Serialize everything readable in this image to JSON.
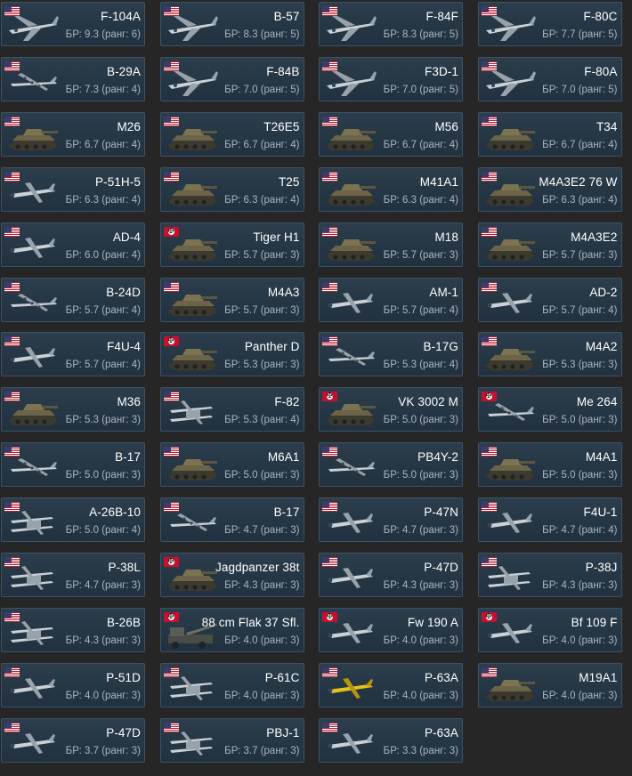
{
  "br_prefix": "БР:",
  "rank_prefix": "ранг:",
  "vehicles": [
    {
      "name": "F-104A",
      "br": "9.3",
      "rank": "6",
      "type": "jet",
      "nation": "usa"
    },
    {
      "name": "B-57",
      "br": "8.3",
      "rank": "5",
      "type": "jet",
      "nation": "usa"
    },
    {
      "name": "F-84F",
      "br": "8.3",
      "rank": "5",
      "type": "jet",
      "nation": "usa"
    },
    {
      "name": "F-80C",
      "br": "7.7",
      "rank": "5",
      "type": "jet",
      "nation": "usa"
    },
    {
      "name": "B-29A",
      "br": "7.3",
      "rank": "4",
      "type": "bomber",
      "nation": "usa"
    },
    {
      "name": "F-84B",
      "br": "7.0",
      "rank": "5",
      "type": "jet",
      "nation": "usa"
    },
    {
      "name": "F3D-1",
      "br": "7.0",
      "rank": "5",
      "type": "jet",
      "nation": "usa"
    },
    {
      "name": "F-80A",
      "br": "7.0",
      "rank": "5",
      "type": "jet",
      "nation": "usa"
    },
    {
      "name": "M26",
      "br": "6.7",
      "rank": "4",
      "type": "tank",
      "nation": "usa"
    },
    {
      "name": "T26E5",
      "br": "6.7",
      "rank": "4",
      "type": "tank",
      "nation": "usa"
    },
    {
      "name": "M56",
      "br": "6.7",
      "rank": "4",
      "type": "tank",
      "nation": "usa"
    },
    {
      "name": "T34",
      "br": "6.7",
      "rank": "4",
      "type": "tank",
      "nation": "usa"
    },
    {
      "name": "P-51H-5",
      "br": "6.3",
      "rank": "4",
      "type": "fighter",
      "nation": "usa"
    },
    {
      "name": "T25",
      "br": "6.3",
      "rank": "4",
      "type": "tank",
      "nation": "usa"
    },
    {
      "name": "M41A1",
      "br": "6.3",
      "rank": "4",
      "type": "tank",
      "nation": "usa"
    },
    {
      "name": "M4A3E2 76 W",
      "br": "6.3",
      "rank": "4",
      "type": "tank",
      "nation": "usa"
    },
    {
      "name": "AD-4",
      "br": "6.0",
      "rank": "4",
      "type": "fighter",
      "nation": "usa"
    },
    {
      "name": "Tiger H1",
      "br": "5.7",
      "rank": "3",
      "type": "tank",
      "nation": "ger"
    },
    {
      "name": "M18",
      "br": "5.7",
      "rank": "3",
      "type": "tank",
      "nation": "usa"
    },
    {
      "name": "M4A3E2",
      "br": "5.7",
      "rank": "3",
      "type": "tank",
      "nation": "usa"
    },
    {
      "name": "B-24D",
      "br": "5.7",
      "rank": "4",
      "type": "bomber",
      "nation": "usa"
    },
    {
      "name": "M4A3",
      "br": "5.7",
      "rank": "3",
      "type": "tank",
      "nation": "usa"
    },
    {
      "name": "AM-1",
      "br": "5.7",
      "rank": "4",
      "type": "fighter",
      "nation": "usa"
    },
    {
      "name": "AD-2",
      "br": "5.7",
      "rank": "4",
      "type": "fighter",
      "nation": "usa"
    },
    {
      "name": "F4U-4",
      "br": "5.7",
      "rank": "4",
      "type": "fighter",
      "nation": "usa"
    },
    {
      "name": "Panther D",
      "br": "5.3",
      "rank": "3",
      "type": "tank",
      "nation": "ger"
    },
    {
      "name": "B-17G",
      "br": "5.3",
      "rank": "4",
      "type": "bomber",
      "nation": "usa"
    },
    {
      "name": "M4A2",
      "br": "5.3",
      "rank": "3",
      "type": "tank",
      "nation": "usa"
    },
    {
      "name": "M36",
      "br": "5.3",
      "rank": "3",
      "type": "tank",
      "nation": "usa"
    },
    {
      "name": "F-82",
      "br": "5.3",
      "rank": "4",
      "type": "twin",
      "nation": "usa"
    },
    {
      "name": "VK 3002 M",
      "br": "5.0",
      "rank": "3",
      "type": "tank",
      "nation": "ger"
    },
    {
      "name": "Me 264",
      "br": "5.0",
      "rank": "3",
      "type": "bomber",
      "nation": "ger"
    },
    {
      "name": "B-17",
      "br": "5.0",
      "rank": "3",
      "type": "bomber",
      "nation": "usa"
    },
    {
      "name": "M6A1",
      "br": "5.0",
      "rank": "3",
      "type": "tank",
      "nation": "usa"
    },
    {
      "name": "PB4Y-2",
      "br": "5.0",
      "rank": "3",
      "type": "bomber",
      "nation": "usa"
    },
    {
      "name": "M4A1",
      "br": "5.0",
      "rank": "3",
      "type": "tank",
      "nation": "usa"
    },
    {
      "name": "A-26B-10",
      "br": "5.0",
      "rank": "4",
      "type": "twin",
      "nation": "usa"
    },
    {
      "name": "B-17",
      "br": "4.7",
      "rank": "3",
      "type": "bomber",
      "nation": "usa"
    },
    {
      "name": "P-47N",
      "br": "4.7",
      "rank": "3",
      "type": "fighter",
      "nation": "usa"
    },
    {
      "name": "F4U-1",
      "br": "4.7",
      "rank": "4",
      "type": "fighter",
      "nation": "usa"
    },
    {
      "name": "P-38L",
      "br": "4.7",
      "rank": "3",
      "type": "twin",
      "nation": "usa"
    },
    {
      "name": "Jagdpanzer 38t",
      "br": "4.3",
      "rank": "3",
      "type": "tank",
      "nation": "ger"
    },
    {
      "name": "P-47D",
      "br": "4.3",
      "rank": "3",
      "type": "fighter",
      "nation": "usa"
    },
    {
      "name": "P-38J",
      "br": "4.3",
      "rank": "3",
      "type": "twin",
      "nation": "usa"
    },
    {
      "name": "B-26B",
      "br": "4.3",
      "rank": "3",
      "type": "twin",
      "nation": "usa"
    },
    {
      "name": "88 cm Flak 37 Sfl.",
      "br": "4.0",
      "rank": "3",
      "type": "truck",
      "nation": "ger"
    },
    {
      "name": "Fw 190 A",
      "br": "4.0",
      "rank": "3",
      "type": "fighter",
      "nation": "ger"
    },
    {
      "name": "Bf 109 F",
      "br": "4.0",
      "rank": "3",
      "type": "fighter",
      "nation": "ger"
    },
    {
      "name": "P-51D",
      "br": "4.0",
      "rank": "3",
      "type": "fighter",
      "nation": "usa"
    },
    {
      "name": "P-61C",
      "br": "4.0",
      "rank": "3",
      "type": "twin",
      "nation": "usa"
    },
    {
      "name": "P-63A",
      "br": "4.0",
      "rank": "3",
      "type": "fighter",
      "nation": "usa",
      "accent": "#e8c21a"
    },
    {
      "name": "M19A1",
      "br": "4.0",
      "rank": "3",
      "type": "tank",
      "nation": "usa"
    },
    {
      "name": "P-47D",
      "br": "3.7",
      "rank": "3",
      "type": "fighter",
      "nation": "usa"
    },
    {
      "name": "PBJ-1",
      "br": "3.7",
      "rank": "3",
      "type": "twin",
      "nation": "usa"
    },
    {
      "name": "P-63A",
      "br": "3.3",
      "rank": "3",
      "type": "fighter",
      "nation": "usa"
    }
  ],
  "colors": {
    "background": "#262626",
    "card": "#253644",
    "name": "#ffffff",
    "br": "#a9b6c1"
  }
}
